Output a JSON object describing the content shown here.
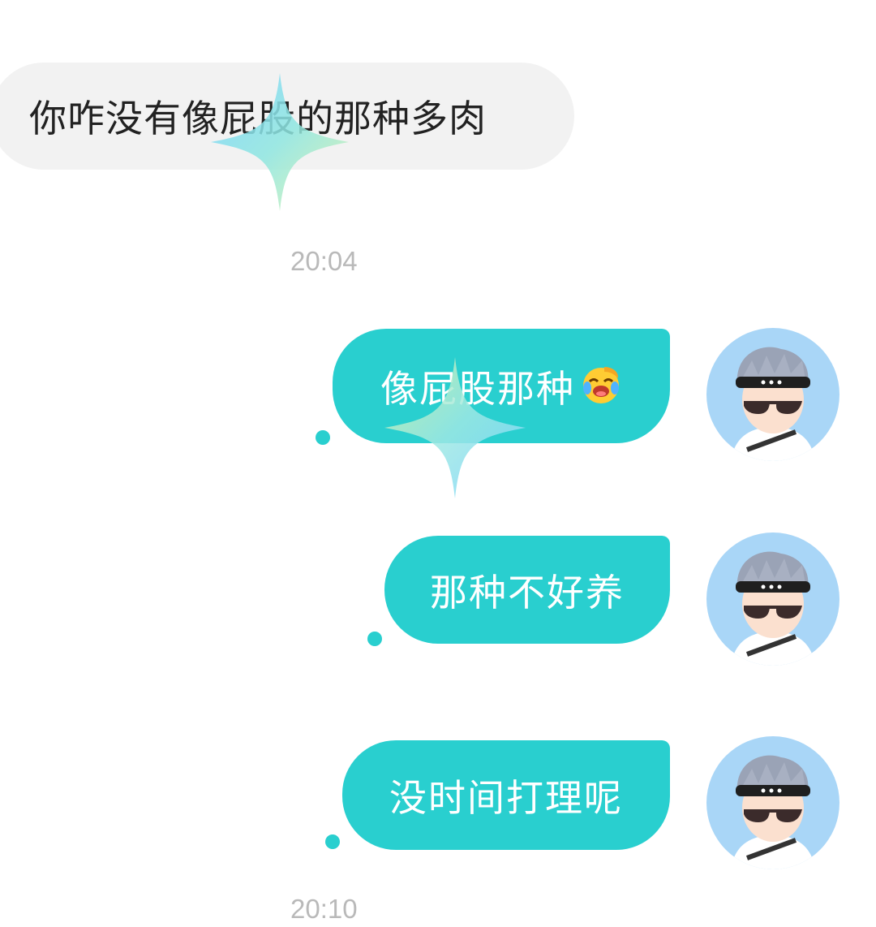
{
  "messages": [
    {
      "side": "incoming",
      "text": "你咋没有像屁股的那种多肉"
    },
    {
      "side": "outgoing",
      "text": "像屁股那种",
      "emoji": "crying-laughing-emoji"
    },
    {
      "side": "outgoing",
      "text": "那种不好养"
    },
    {
      "side": "outgoing",
      "text": "没时间打理呢"
    }
  ],
  "timestamps": [
    "20:04",
    "20:10"
  ],
  "colors": {
    "outgoing_bubble": "#29cfcf",
    "incoming_bubble": "#f2f2f2",
    "timestamp": "#b9b9b9",
    "avatar_bg": "#a9d6f7"
  },
  "avatar": {
    "icon": "user-avatar-icon"
  }
}
